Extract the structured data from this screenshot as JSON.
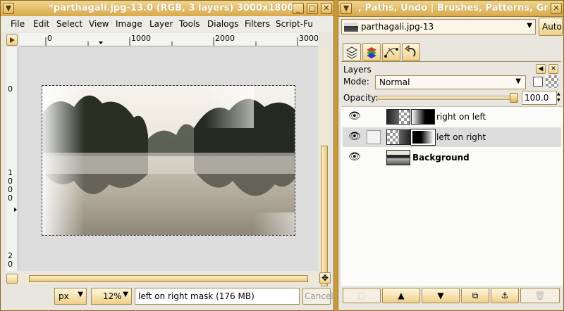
{
  "image_window": {
    "title": "*parthagali.jpg-13.0 (RGB, 3 layers) 3000x1800",
    "menu": [
      "File",
      "Edit",
      "Select",
      "View",
      "Image",
      "Layer",
      "Tools",
      "Dialogs",
      "Filters",
      "Script-Fu"
    ],
    "ruler_h_labels": [
      "0",
      "1000",
      "2000",
      "3000"
    ],
    "ruler_v_labels": [
      "0",
      "1",
      "0",
      "0",
      "0",
      "2",
      "0",
      "0"
    ],
    "unit": "px",
    "zoom": "12%",
    "status_text": "left on right mask (176 MB)",
    "cancel_label": "Cancel"
  },
  "dock_window": {
    "title": ", Paths, Undo | Brushes, Patterns, Gr",
    "image_selector": "parthagali.jpg-13",
    "auto_label": "Auto",
    "layers_title": "Layers",
    "mode_label": "Mode:",
    "mode_value": "Normal",
    "opacity_label": "Opacity:",
    "opacity_value": "100.0",
    "layers": [
      {
        "name": "right on left",
        "bold": false
      },
      {
        "name": "left on right",
        "bold": false
      },
      {
        "name": "Background",
        "bold": true
      }
    ]
  }
}
